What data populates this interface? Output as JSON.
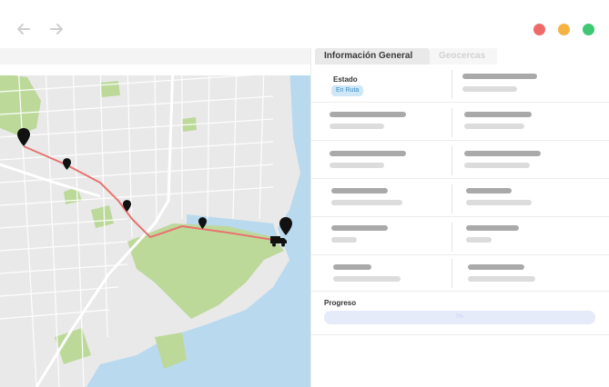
{
  "tabs": [
    {
      "label": "Información General"
    },
    {
      "label": "Geocercas"
    }
  ],
  "status": {
    "label": "Estado",
    "value": "En Ruta"
  },
  "progress": {
    "label": "Progreso",
    "value_text": "0%"
  },
  "colors": {
    "route": "#e8736f",
    "water": "#b9d9ef",
    "park": "#bcd99a",
    "status_badge_bg": "#cfe7f7",
    "status_badge_text": "#3b8fc8",
    "progress_track": "#e6ebfa",
    "window_red": "#f06a6a",
    "window_yellow": "#f5b342",
    "window_green": "#3fc874"
  },
  "icons": {
    "back": "arrow-left-icon",
    "forward": "arrow-right-icon",
    "pin": "map-pin-icon",
    "truck": "truck-icon"
  }
}
